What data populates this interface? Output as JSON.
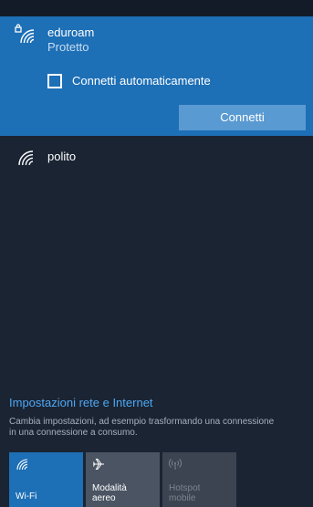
{
  "networks": [
    {
      "name": "eduroam",
      "status": "Protetto",
      "secured": true,
      "expanded": true,
      "auto_connect_label": "Connetti automaticamente",
      "auto_connect_checked": false,
      "connect_label": "Connetti"
    },
    {
      "name": "polito",
      "secured": false,
      "expanded": false
    }
  ],
  "settings": {
    "link": "Impostazioni rete e Internet",
    "description": "Cambia impostazioni, ad esempio trasformando una connessione in una connessione a consumo."
  },
  "quick_actions": [
    {
      "label": "Wi-Fi",
      "icon": "wifi-icon",
      "active": true,
      "enabled": true
    },
    {
      "label": "Modalità aereo",
      "label_line1": "Modalità",
      "label_line2": "aereo",
      "icon": "airplane-icon",
      "active": false,
      "enabled": true
    },
    {
      "label": "Hotspot mobile",
      "label_line1": "Hotspot",
      "label_line2": "mobile",
      "icon": "hotspot-icon",
      "active": false,
      "enabled": false
    }
  ],
  "colors": {
    "accent": "#1d6fb6",
    "button": "#5a9ad2",
    "link": "#4fa7f2",
    "background": "#1a2433"
  }
}
